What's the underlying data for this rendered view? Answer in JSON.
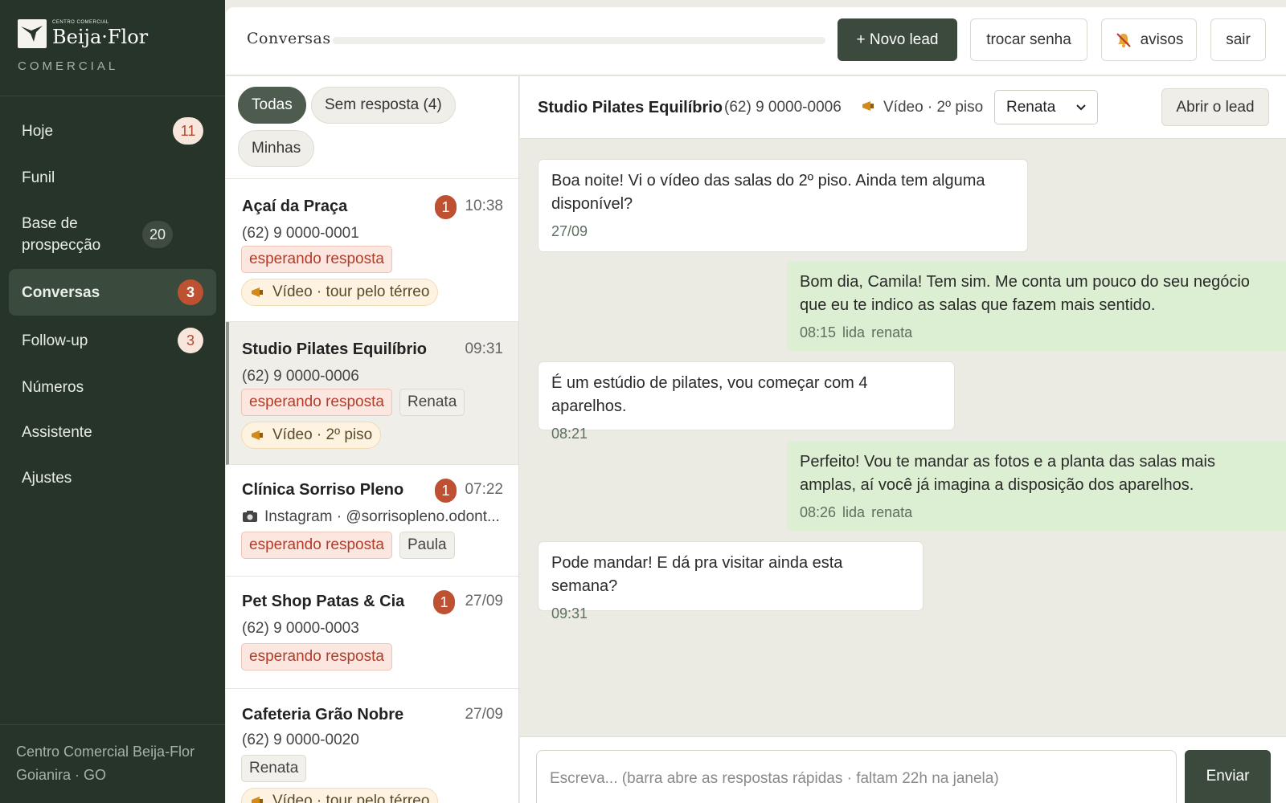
{
  "brand": {
    "small": "CENTRO COMERCIAL",
    "name": "Beija·Flor",
    "sub": "COMERCIAL"
  },
  "nav": [
    {
      "label": "Hoje",
      "badge": "11",
      "badge_style": "light",
      "active": false
    },
    {
      "label": "Funil",
      "badge": "",
      "active": false
    },
    {
      "label": "Base de prospecção",
      "badge": "20",
      "badge_style": "dark",
      "active": false
    },
    {
      "label": "Conversas",
      "badge": "3",
      "badge_style": "red",
      "active": true
    },
    {
      "label": "Follow-up",
      "badge": "3",
      "badge_style": "light",
      "active": false
    },
    {
      "label": "Números",
      "badge": "",
      "active": false
    },
    {
      "label": "Assistente",
      "badge": "",
      "active": false
    },
    {
      "label": "Ajustes",
      "badge": "",
      "active": false
    }
  ],
  "footer": {
    "line1": "Centro Comercial Beija-Flor",
    "line2": "Goianira · GO"
  },
  "header": {
    "title": "Conversas",
    "new_lead": "+ Novo lead",
    "change_password": "trocar senha",
    "alerts": "avisos",
    "logout": "sair"
  },
  "filters": {
    "all": "Todas",
    "no_reply": "Sem resposta (4)",
    "mine": "Minhas"
  },
  "conversations": [
    {
      "name": "Açaí da Praça",
      "unread": "1",
      "time": "10:38",
      "sub": "(62) 9 0000-0001",
      "status": "esperando resposta",
      "user": "",
      "source": "Vídeo · tour pelo térreo"
    },
    {
      "name": "Studio Pilates Equilíbrio",
      "unread": "",
      "time": "09:31",
      "sub": "(62) 9 0000-0006",
      "status": "esperando resposta",
      "user": "Renata",
      "source": "Vídeo · 2º piso"
    },
    {
      "name": "Clínica Sorriso Pleno",
      "unread": "1",
      "time": "07:22",
      "sub": "Instagram · @sorrisopleno.odont...",
      "status": "esperando resposta",
      "user": "Paula",
      "source": ""
    },
    {
      "name": "Pet Shop Patas & Cia",
      "unread": "1",
      "time": "27/09",
      "sub": "(62) 9 0000-0003",
      "status": "esperando resposta",
      "user": "",
      "source": ""
    },
    {
      "name": "Cafeteria Grão Nobre",
      "unread": "",
      "time": "27/09",
      "sub": "(62) 9 0000-0020",
      "status": "",
      "user": "Renata",
      "source": "Vídeo · tour pelo térreo"
    }
  ],
  "chat": {
    "name": "Studio Pilates Equilíbrio",
    "phone": "(62) 9 0000-0006",
    "source": "Vídeo · 2º piso",
    "assignee": "Renata",
    "open_lead": "Abrir o lead",
    "messages": [
      {
        "dir": "in",
        "text": "Boa noite! Vi o vídeo das salas do 2º piso. Ainda tem alguma disponível?",
        "time": "27/09",
        "status": "",
        "author": ""
      },
      {
        "dir": "out",
        "text": "Bom dia, Camila! Tem sim. Me conta um pouco do seu negócio que eu te indico as salas que fazem mais sentido.",
        "time": "08:15",
        "status": "lida",
        "author": "renata"
      },
      {
        "dir": "in",
        "text": "É um estúdio de pilates, vou começar com 4 aparelhos.",
        "time": "08:21",
        "status": "",
        "author": ""
      },
      {
        "dir": "out",
        "text": "Perfeito! Vou te mandar as fotos e a planta das salas mais amplas, aí você já imagina a disposição dos aparelhos.",
        "time": "08:26",
        "status": "lida",
        "author": "renata"
      },
      {
        "dir": "in",
        "text": "Pode mandar! E dá pra visitar ainda esta semana?",
        "time": "09:31",
        "status": "",
        "author": ""
      }
    ],
    "composer_placeholder": "Escreva... (barra abre as respostas rápidas · faltam 22h na janela)",
    "send": "Enviar"
  },
  "colors": {
    "sidebar": "#27342a",
    "accent": "#3c4a3d",
    "badge_red": "#bd5131",
    "out_bubble": "#dcefd2"
  }
}
